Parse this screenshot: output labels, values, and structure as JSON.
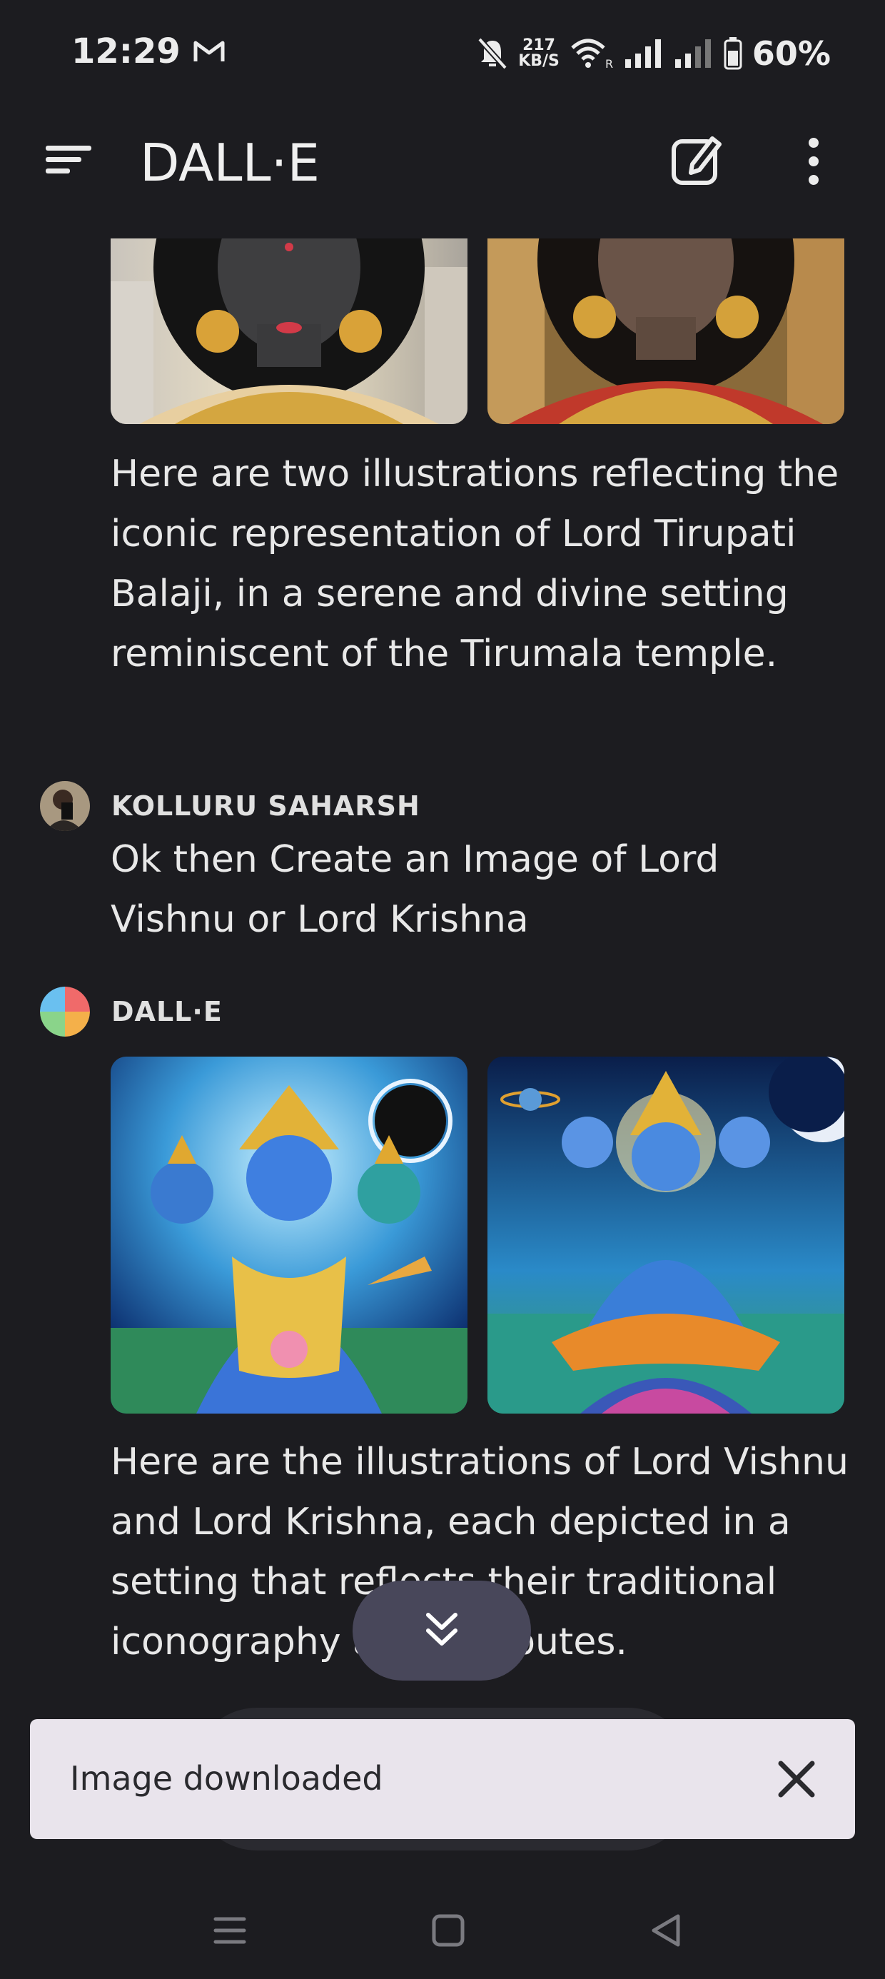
{
  "status_bar": {
    "time": "12:29",
    "net_speed_value": "217",
    "net_speed_unit": "KB/S",
    "battery": "60%",
    "icons": [
      "gmail-icon",
      "mute-icon",
      "wifi-icon",
      "signal-icon",
      "signal-icon-2",
      "battery-icon"
    ]
  },
  "app_bar": {
    "title": "DALL·E"
  },
  "messages": [
    {
      "text": "Here are two illustrations reflecting the iconic representation of Lord Tirupati Balaji, in a serene and divine setting reminiscent of the Tirumala temple."
    },
    {
      "author": "KOLLURU SAHARSH",
      "text": "Ok then Create an Image of Lord Vishnu or Lord Krishna"
    },
    {
      "author": "DALL·E",
      "text": "Here are the illustrations of Lord Vishnu and Lord Krishna, each depicted in a setting that reflects their traditional iconography and attributes."
    }
  ],
  "snackbar": {
    "text": "Image downloaded"
  },
  "colors": {
    "background": "#1c1c20",
    "snackbar": "#e9e4ec",
    "scroll_button": "#48475a"
  }
}
